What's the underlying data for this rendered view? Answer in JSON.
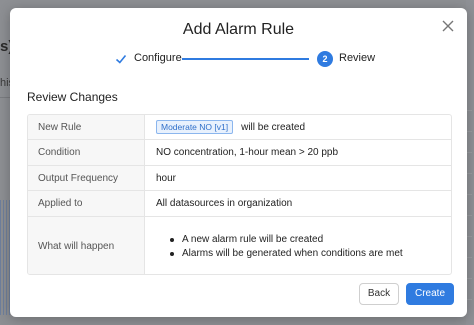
{
  "background": {
    "title_fragment": "s)",
    "text_fragment": "his"
  },
  "modal": {
    "title": "Add Alarm Rule",
    "steps": [
      {
        "label": "Configure",
        "state": "completed",
        "icon": "check-icon"
      },
      {
        "number": "2",
        "label": "Review",
        "state": "active"
      }
    ],
    "section_title": "Review Changes",
    "rows": {
      "new_rule": {
        "label": "New Rule",
        "badge": "Moderate NO [v1]",
        "suffix": "will be created"
      },
      "condition": {
        "label": "Condition",
        "value": "NO concentration, 1-hour mean > 20 ppb"
      },
      "output_frequency": {
        "label": "Output Frequency",
        "value": "hour"
      },
      "applied_to": {
        "label": "Applied to",
        "value": "All datasources in organization"
      },
      "what_will_happen": {
        "label": "What will happen",
        "items": [
          "A new alarm rule will be created",
          "Alarms will be generated when conditions are met"
        ]
      }
    },
    "buttons": {
      "back": "Back",
      "create": "Create"
    }
  },
  "colors": {
    "accent": "#2f7be0",
    "badge_bg": "#e8f1fd",
    "overlay": "#8d8f93"
  }
}
